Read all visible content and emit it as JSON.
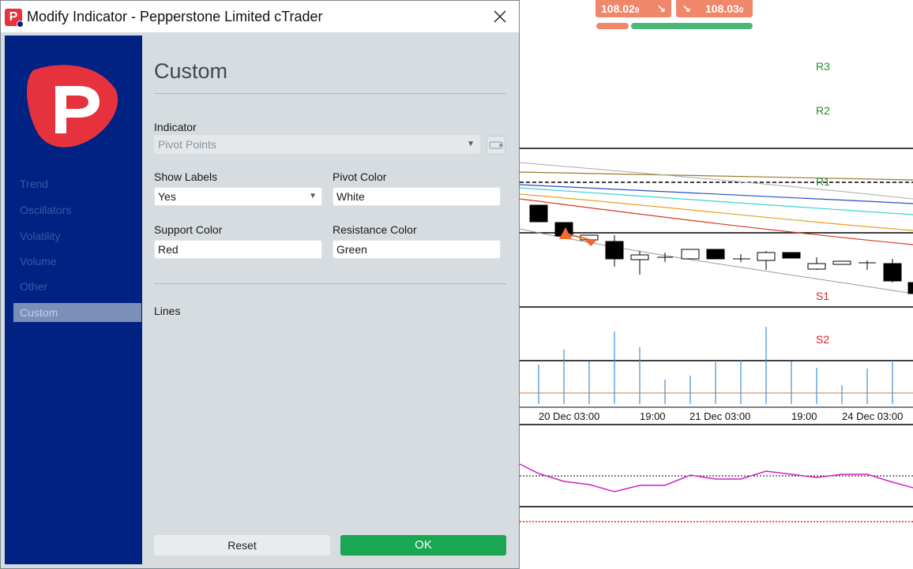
{
  "window": {
    "title": "Modify Indicator - Pepperstone Limited cTrader",
    "icon_letter": "P",
    "close_icon": "close-icon"
  },
  "sidebar": {
    "logo": "pepperstone-logo",
    "items": [
      {
        "label": "Trend",
        "active": false
      },
      {
        "label": "Oscillators",
        "active": false
      },
      {
        "label": "Volatility",
        "active": false
      },
      {
        "label": "Volume",
        "active": false
      },
      {
        "label": "Other",
        "active": false
      },
      {
        "label": "Custom",
        "active": true
      }
    ]
  },
  "content": {
    "title": "Custom",
    "indicator_label": "Indicator",
    "indicator_value": "Pivot Points",
    "show_labels_label": "Show Labels",
    "show_labels_value": "Yes",
    "pivot_color_label": "Pivot Color",
    "pivot_color_value": "White",
    "support_color_label": "Support Color",
    "support_color_value": "Red",
    "resistance_color_label": "Resistance Color",
    "resistance_color_value": "Green",
    "lines_label": "Lines"
  },
  "buttons": {
    "reset": "Reset",
    "ok": "OK"
  },
  "chart": {
    "sell_price": "108.02",
    "sell_price_sub": "9",
    "buy_price": "108.03",
    "buy_price_sub": "0",
    "levels": {
      "r3": "R3",
      "r2": "R2",
      "r1": "R1",
      "s1": "S1",
      "s2": "S2"
    },
    "time_labels": [
      "20 Dec 03:00",
      "19:00",
      "21 Dec 03:00",
      "19:00",
      "24 Dec 03:00"
    ]
  },
  "colors": {
    "accent_green": "#1aa652",
    "sidebar_blue": "#002282",
    "brand_red": "#e6323c",
    "price_orange": "#f0876a",
    "resistance_green": "#2e8b2e",
    "support_red": "#e02020"
  }
}
